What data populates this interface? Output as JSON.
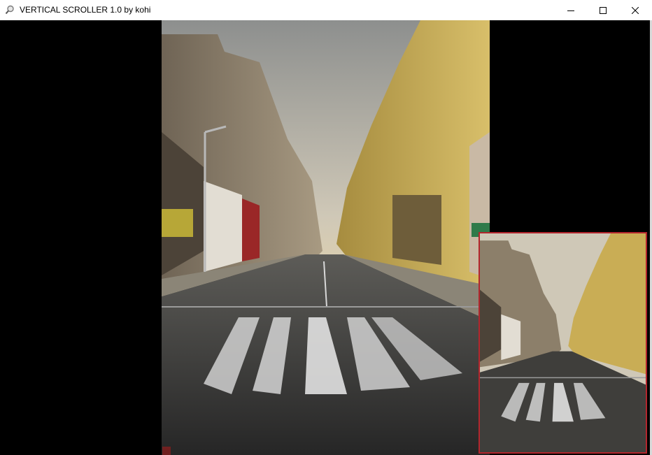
{
  "window": {
    "title": "VERTICAL SCROLLER 1.0 by kohi",
    "app_icon": "magnifier-icon",
    "controls": [
      "minimize-icon",
      "maximize-icon",
      "close-icon"
    ]
  },
  "viewer": {
    "main_image": "city-street-crosswalk-photo",
    "preview_image": "city-street-crosswalk-thumbnail",
    "preview_border_color": "#b3262d",
    "background_color": "#000000"
  }
}
